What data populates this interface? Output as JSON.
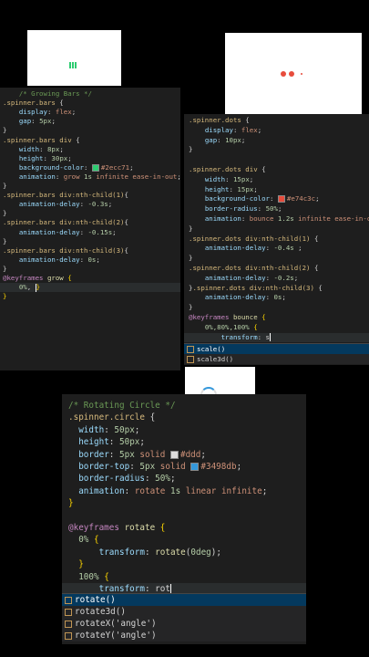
{
  "colors": {
    "green": "#2ecc71",
    "red": "#e74c3c",
    "blue": "#3498db",
    "light": "#ddd"
  },
  "editor_bars": {
    "lines": [
      [
        "    ",
        {
          "c": "com",
          "t": "/* Growing Bars */"
        }
      ],
      [
        {
          "c": "sel",
          "t": ".spinner.bars"
        },
        {
          "c": "punc",
          "t": " {"
        }
      ],
      [
        "    ",
        {
          "c": "prop",
          "t": "display"
        },
        {
          "c": "punc",
          "t": ": "
        },
        {
          "c": "val",
          "t": "flex"
        },
        {
          "c": "punc",
          "t": ";"
        }
      ],
      [
        "    ",
        {
          "c": "prop",
          "t": "gap"
        },
        {
          "c": "punc",
          "t": ": "
        },
        {
          "c": "num",
          "t": "5px"
        },
        {
          "c": "punc",
          "t": ";"
        }
      ],
      [
        {
          "c": "punc",
          "t": "}"
        }
      ],
      [
        {
          "c": "sel",
          "t": ".spinner.bars div"
        },
        {
          "c": "punc",
          "t": " {"
        }
      ],
      [
        "    ",
        {
          "c": "prop",
          "t": "width"
        },
        {
          "c": "punc",
          "t": ": "
        },
        {
          "c": "num",
          "t": "8px"
        },
        {
          "c": "punc",
          "t": ";"
        }
      ],
      [
        "    ",
        {
          "c": "prop",
          "t": "height"
        },
        {
          "c": "punc",
          "t": ": "
        },
        {
          "c": "num",
          "t": "30px"
        },
        {
          "c": "punc",
          "t": ";"
        }
      ],
      [
        "    ",
        {
          "c": "prop",
          "t": "background-color"
        },
        {
          "c": "punc",
          "t": ": "
        },
        {
          "sw": "#2ecc71"
        },
        {
          "c": "val",
          "t": "#2ecc71"
        },
        {
          "c": "punc",
          "t": ";"
        }
      ],
      [
        "    ",
        {
          "c": "prop",
          "t": "animation"
        },
        {
          "c": "punc",
          "t": ": "
        },
        {
          "c": "val",
          "t": "grow "
        },
        {
          "c": "num",
          "t": "1s"
        },
        {
          "c": "val",
          "t": " infinite ease-in-out"
        },
        {
          "c": "punc",
          "t": ";"
        }
      ],
      [
        {
          "c": "punc",
          "t": "}"
        }
      ],
      [
        {
          "c": "sel",
          "t": ".spinner.bars div:nth-child(1)"
        },
        {
          "c": "punc",
          "t": "{"
        }
      ],
      [
        "    ",
        {
          "c": "prop",
          "t": "animation-delay"
        },
        {
          "c": "punc",
          "t": ": "
        },
        {
          "c": "num",
          "t": "-0.3s"
        },
        {
          "c": "punc",
          "t": ";"
        }
      ],
      [
        {
          "c": "punc",
          "t": "}"
        }
      ],
      [
        {
          "c": "sel",
          "t": ".spinner.bars div:nth-child(2)"
        },
        {
          "c": "punc",
          "t": "{"
        }
      ],
      [
        "    ",
        {
          "c": "prop",
          "t": "animation-delay"
        },
        {
          "c": "punc",
          "t": ": "
        },
        {
          "c": "num",
          "t": "-0.15s"
        },
        {
          "c": "punc",
          "t": ";"
        }
      ],
      [
        {
          "c": "punc",
          "t": "}"
        }
      ],
      [
        {
          "c": "sel",
          "t": ".spinner.bars div:nth-child(3)"
        },
        {
          "c": "punc",
          "t": "{"
        }
      ],
      [
        "    ",
        {
          "c": "prop",
          "t": "animation-delay"
        },
        {
          "c": "punc",
          "t": ": "
        },
        {
          "c": "num",
          "t": "0s"
        },
        {
          "c": "punc",
          "t": ";"
        }
      ],
      [
        {
          "c": "punc",
          "t": "}"
        }
      ],
      [
        {
          "c": "kw",
          "t": "@keyframes"
        },
        {
          "c": "fn",
          "t": " grow "
        },
        {
          "c": "brace",
          "t": "{"
        }
      ],
      [
        "    ",
        {
          "c": "num",
          "t": "0%"
        },
        {
          "c": "punc",
          "t": ", "
        },
        {
          "cur": true
        },
        {
          "c": "brace",
          "t": "}"
        }
      ],
      [
        {
          "c": "brace",
          "t": "}"
        }
      ]
    ]
  },
  "editor_dots": {
    "lines": [
      [
        {
          "c": "sel",
          "t": ".spinner.dots"
        },
        {
          "c": "punc",
          "t": " {"
        }
      ],
      [
        "    ",
        {
          "c": "prop",
          "t": "display"
        },
        {
          "c": "punc",
          "t": ": "
        },
        {
          "c": "val",
          "t": "flex"
        },
        {
          "c": "punc",
          "t": ";"
        }
      ],
      [
        "    ",
        {
          "c": "prop",
          "t": "gap"
        },
        {
          "c": "punc",
          "t": ": "
        },
        {
          "c": "num",
          "t": "10px"
        },
        {
          "c": "punc",
          "t": ";"
        }
      ],
      [
        {
          "c": "punc",
          "t": "}"
        }
      ],
      [
        ""
      ],
      [
        {
          "c": "sel",
          "t": ".spinner.dots div"
        },
        {
          "c": "punc",
          "t": " {"
        }
      ],
      [
        "    ",
        {
          "c": "prop",
          "t": "width"
        },
        {
          "c": "punc",
          "t": ": "
        },
        {
          "c": "num",
          "t": "15px"
        },
        {
          "c": "punc",
          "t": ";"
        }
      ],
      [
        "    ",
        {
          "c": "prop",
          "t": "height"
        },
        {
          "c": "punc",
          "t": ": "
        },
        {
          "c": "num",
          "t": "15px"
        },
        {
          "c": "punc",
          "t": ";"
        }
      ],
      [
        "    ",
        {
          "c": "prop",
          "t": "background-color"
        },
        {
          "c": "punc",
          "t": ": "
        },
        {
          "sw": "#e74c3c"
        },
        {
          "c": "val",
          "t": "#e74c3c"
        },
        {
          "c": "punc",
          "t": ";"
        }
      ],
      [
        "    ",
        {
          "c": "prop",
          "t": "border-radius"
        },
        {
          "c": "punc",
          "t": ": "
        },
        {
          "c": "num",
          "t": "50%"
        },
        {
          "c": "punc",
          "t": ";"
        }
      ],
      [
        "    ",
        {
          "c": "prop",
          "t": "animation"
        },
        {
          "c": "punc",
          "t": ": "
        },
        {
          "c": "val",
          "t": "bounce "
        },
        {
          "c": "num",
          "t": "1.2s"
        },
        {
          "c": "val",
          "t": " infinite ease-in-out"
        }
      ],
      [
        {
          "c": "punc",
          "t": "}"
        }
      ],
      [
        {
          "c": "sel",
          "t": ".spinner.dots div:nth-child(1)"
        },
        {
          "c": "punc",
          "t": " {"
        }
      ],
      [
        "    ",
        {
          "c": "prop",
          "t": "animation-delay"
        },
        {
          "c": "punc",
          "t": ": "
        },
        {
          "c": "num",
          "t": "-0.4s"
        },
        {
          "c": "punc",
          "t": " ;"
        }
      ],
      [
        {
          "c": "punc",
          "t": "}"
        }
      ],
      [
        {
          "c": "sel",
          "t": ".spinner.dots div:nth-child(2)"
        },
        {
          "c": "punc",
          "t": " {"
        }
      ],
      [
        "    ",
        {
          "c": "prop",
          "t": "animation-delay"
        },
        {
          "c": "punc",
          "t": ": "
        },
        {
          "c": "num",
          "t": "-0.2s"
        },
        {
          "c": "punc",
          "t": ";"
        }
      ],
      [
        {
          "c": "punc",
          "t": "}"
        },
        {
          "c": "sel",
          "t": ".spinner.dots div:nth-child(3)"
        },
        {
          "c": "punc",
          "t": " {"
        }
      ],
      [
        "    ",
        {
          "c": "prop",
          "t": "animation-delay"
        },
        {
          "c": "punc",
          "t": ": "
        },
        {
          "c": "num",
          "t": "0s"
        },
        {
          "c": "punc",
          "t": ";"
        }
      ],
      [
        {
          "c": "punc",
          "t": "}"
        }
      ],
      [
        {
          "c": "kw",
          "t": "@keyframes"
        },
        {
          "c": "fn",
          "t": " bounce "
        },
        {
          "c": "brace",
          "t": "{"
        }
      ],
      [
        "    ",
        {
          "c": "num",
          "t": "0%,80%,100%"
        },
        {
          "c": "punc",
          "t": " "
        },
        {
          "c": "brace",
          "t": "{"
        }
      ],
      [
        "        ",
        {
          "c": "prop",
          "t": "transform"
        },
        {
          "c": "punc",
          "t": ": s"
        },
        {
          "cur": true
        }
      ]
    ],
    "suggestions": [
      "scale()",
      "scale3d()"
    ]
  },
  "editor_circle": {
    "lines": [
      [
        {
          "c": "com",
          "t": "/* Rotating Circle */"
        }
      ],
      [
        {
          "c": "sel",
          "t": ".spinner.circle"
        },
        {
          "c": "punc",
          "t": " {"
        }
      ],
      [
        "  ",
        {
          "c": "prop",
          "t": "width"
        },
        {
          "c": "punc",
          "t": ": "
        },
        {
          "c": "num",
          "t": "50px"
        },
        {
          "c": "punc",
          "t": ";"
        }
      ],
      [
        "  ",
        {
          "c": "prop",
          "t": "height"
        },
        {
          "c": "punc",
          "t": ": "
        },
        {
          "c": "num",
          "t": "50px"
        },
        {
          "c": "punc",
          "t": ";"
        }
      ],
      [
        "  ",
        {
          "c": "prop",
          "t": "border"
        },
        {
          "c": "punc",
          "t": ": "
        },
        {
          "c": "num",
          "t": "5px"
        },
        {
          "c": "val",
          "t": " solid "
        },
        {
          "sw": "#ddd"
        },
        {
          "c": "val",
          "t": "#ddd"
        },
        {
          "c": "punc",
          "t": ";"
        }
      ],
      [
        "  ",
        {
          "c": "prop",
          "t": "border-top"
        },
        {
          "c": "punc",
          "t": ": "
        },
        {
          "c": "num",
          "t": "5px"
        },
        {
          "c": "val",
          "t": " solid "
        },
        {
          "sw": "#3498db"
        },
        {
          "c": "val",
          "t": "#3498db"
        },
        {
          "c": "punc",
          "t": ";"
        }
      ],
      [
        "  ",
        {
          "c": "prop",
          "t": "border-radius"
        },
        {
          "c": "punc",
          "t": ": "
        },
        {
          "c": "num",
          "t": "50%"
        },
        {
          "c": "punc",
          "t": ";"
        }
      ],
      [
        "  ",
        {
          "c": "prop",
          "t": "animation"
        },
        {
          "c": "punc",
          "t": ": "
        },
        {
          "c": "val",
          "t": "rotate "
        },
        {
          "c": "num",
          "t": "1s"
        },
        {
          "c": "val",
          "t": " linear infinite"
        },
        {
          "c": "punc",
          "t": ";"
        }
      ],
      [
        {
          "c": "brace",
          "t": "}"
        }
      ],
      [
        ""
      ],
      [
        {
          "c": "kw",
          "t": "@keyframes"
        },
        {
          "c": "fn",
          "t": " rotate "
        },
        {
          "c": "brace",
          "t": "{"
        }
      ],
      [
        "  ",
        {
          "c": "num",
          "t": "0%"
        },
        {
          "c": "punc",
          "t": " "
        },
        {
          "c": "brace",
          "t": "{"
        }
      ],
      [
        "      ",
        {
          "c": "prop",
          "t": "transform"
        },
        {
          "c": "punc",
          "t": ": "
        },
        {
          "c": "fn",
          "t": "rotate"
        },
        {
          "c": "punc",
          "t": "("
        },
        {
          "c": "num",
          "t": "0deg"
        },
        {
          "c": "punc",
          "t": ");"
        }
      ],
      [
        "  ",
        {
          "c": "brace",
          "t": "}"
        }
      ],
      [
        "  ",
        {
          "c": "num",
          "t": "100%"
        },
        {
          "c": "punc",
          "t": " "
        },
        {
          "c": "brace",
          "t": "{"
        }
      ],
      [
        "      ",
        {
          "c": "prop",
          "t": "transform"
        },
        {
          "c": "punc",
          "t": ": rot"
        },
        {
          "cur": true
        }
      ]
    ],
    "suggestions": [
      "rotate()",
      "rotate3d()",
      "rotateX('angle')",
      "rotateY('angle')"
    ]
  }
}
